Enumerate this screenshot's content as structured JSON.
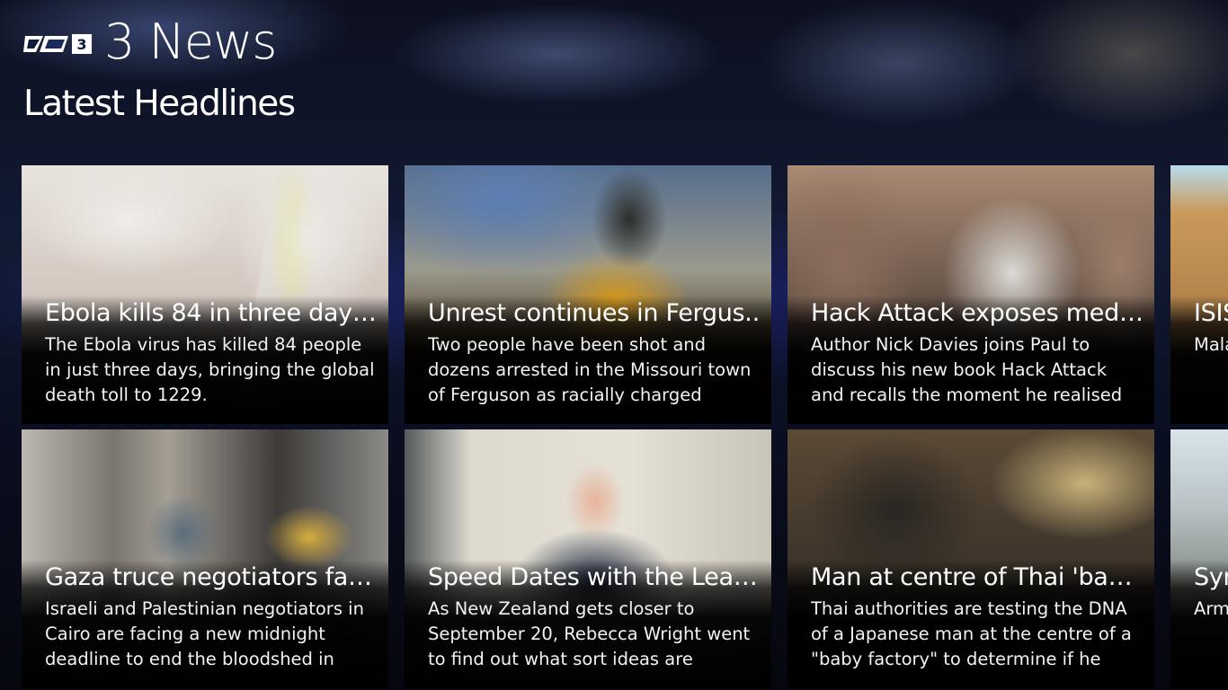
{
  "header": {
    "logo_icon": "tv3-logo-icon",
    "app_title": "3 News",
    "section_title": "Latest Headlines"
  },
  "tiles": [
    {
      "headline": "Ebola kills 84 in three days...",
      "summary": "The Ebola virus has killed 84 people in just three days, bringing the global death toll to 1229."
    },
    {
      "headline": "Unrest continues in Fergus..",
      "summary": "Two people have been shot and dozens arrested in the Missouri town of Ferguson as racially charged unrest"
    },
    {
      "headline": "Hack Attack exposes medi...",
      "summary": "Author Nick Davies joins Paul to discuss his new book Hack Attack and recalls the moment he realised that"
    },
    {
      "headline": "ISIS",
      "summary": "Mala a wa mili"
    },
    {
      "headline": "Gaza truce negotiators fac...",
      "summary": "Israeli and Palestinian negotiators in Cairo are facing a new midnight deadline to end the bloodshed in"
    },
    {
      "headline": "Speed Dates with the Lead..",
      "summary": "As New Zealand gets closer to September 20, Rebecca Wright went to find out what sort ideas are rattling"
    },
    {
      "headline": "Man at centre of Thai 'bab...",
      "summary": "Thai authorities are testing the DNA of a Japanese man at the centre of a \"baby factory\" to determine if he"
    },
    {
      "headline": "Syr",
      "summary": "Arm hun that"
    }
  ]
}
